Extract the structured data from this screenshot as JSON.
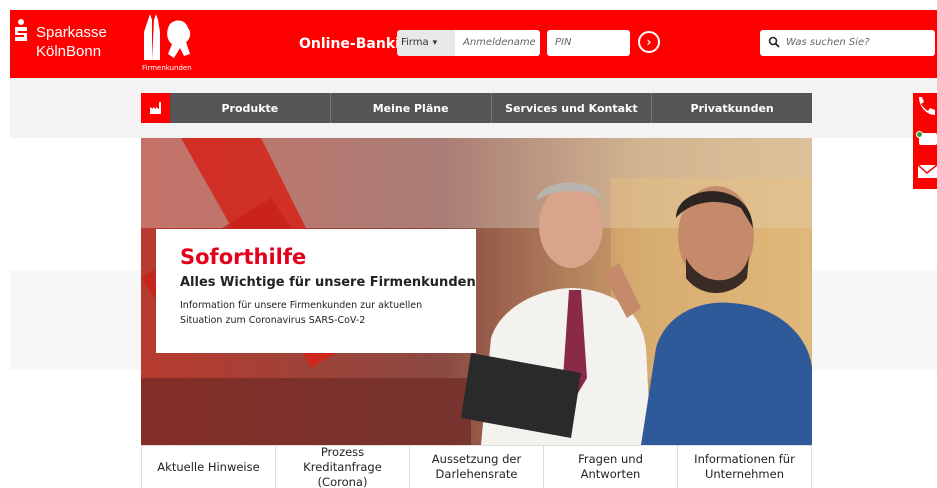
{
  "brand": {
    "line1": "Sparkasse",
    "line2": "KölnBonn",
    "segment_label": "Firmenkunden"
  },
  "login": {
    "title": "Online-Banking",
    "type_select": "Firma",
    "username_placeholder": "Anmeldename",
    "pin_placeholder": "PIN"
  },
  "search": {
    "placeholder": "Was suchen Sie?"
  },
  "nav": {
    "items": [
      "Produkte",
      "Meine Pläne",
      "Services und Kontakt",
      "Privatkunden"
    ]
  },
  "hero": {
    "title": "Soforthilfe",
    "subtitle": "Alles Wichtige für unsere Firmenkunden",
    "text": "Information für unsere Firmenkunden zur aktuellen Situation zum Coronavirus SARS-CoV-2"
  },
  "tabs": [
    "Aktuelle Hinweise",
    "Prozess Kreditanfrage (Corona)",
    "Aussetzung der Darlehensrate",
    "Fragen und Antworten",
    "Informationen für Unternehmen"
  ],
  "colors": {
    "brand_red": "#ff0000",
    "nav_gray": "#555555",
    "headline_red": "#e3001b"
  },
  "icons": [
    "sparkasse-s-logo",
    "cathedral-lion-logo",
    "chevron-down-icon",
    "arrow-right-icon",
    "search-icon",
    "factory-home-icon",
    "phone-icon",
    "chat-icon",
    "mail-icon"
  ]
}
